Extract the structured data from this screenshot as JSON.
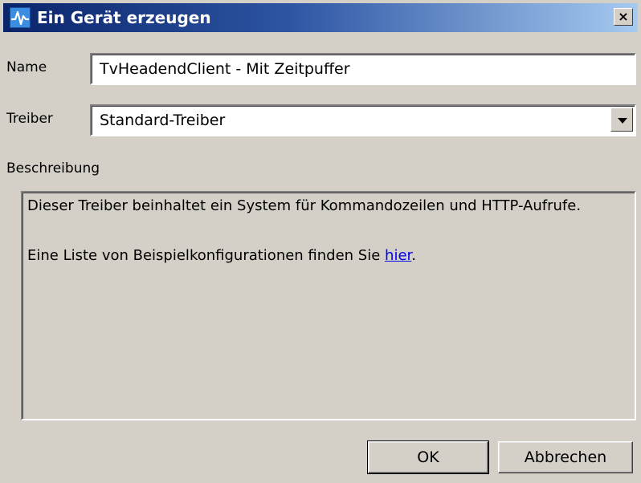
{
  "window": {
    "title": "Ein Gerät erzeugen",
    "close_label": "×"
  },
  "form": {
    "name_label": "Name",
    "name_value": "TvHeadendClient - Mit Zeitpuffer",
    "driver_label": "Treiber",
    "driver_value": "Standard-Treiber",
    "description_label": "Beschreibung"
  },
  "description": {
    "line1": "Dieser Treiber beinhaltet ein System für Kommandozeilen und HTTP-Aufrufe.",
    "line2_prefix": "Eine Liste von Beispielkonfigurationen finden Sie ",
    "line2_link": "hier",
    "line2_suffix": "."
  },
  "buttons": {
    "ok": "OK",
    "cancel": "Abbrechen"
  }
}
